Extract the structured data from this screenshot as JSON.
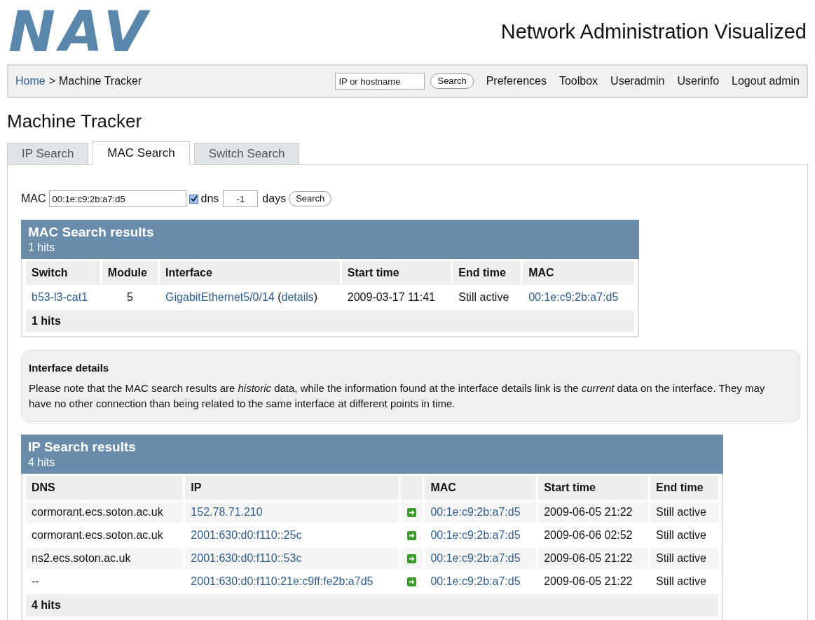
{
  "logo": "NAV",
  "site_title": "Network Administration Visualized",
  "navbar": {
    "breadcrumb": [
      {
        "label": "Home",
        "link": true
      },
      {
        "label": "Machine Tracker",
        "link": false
      }
    ],
    "separator": ">",
    "search": {
      "placeholder": "IP or hostname",
      "button": "Search"
    },
    "links": [
      "Preferences",
      "Toolbox",
      "Useradmin",
      "Userinfo",
      "Logout admin"
    ]
  },
  "page_title": "Machine Tracker",
  "tabs": [
    {
      "label": "IP Search",
      "selected": false
    },
    {
      "label": "MAC Search",
      "selected": true
    },
    {
      "label": "Switch Search",
      "selected": false
    }
  ],
  "form": {
    "mac_label": "MAC",
    "mac_value": "00:1e:c9:2b:a7:d5",
    "dns_checked": true,
    "dns_label": "dns",
    "days_value": "-1",
    "days_label": "days",
    "button": "Search"
  },
  "mac_results": {
    "title": "MAC Search results",
    "hits": "1 hits",
    "columns": [
      "Switch",
      "Module",
      "Interface",
      "Start time",
      "End time",
      "MAC"
    ],
    "rows": [
      {
        "switch": "b53-l3-cat1",
        "module": "5",
        "interface": "GigabitEthernet5/0/14",
        "details_open": "(",
        "details": "details",
        "details_close": ")",
        "start_time": "2009-03-17 11:41",
        "end_time": "Still active",
        "mac": "00:1e:c9:2b:a7:d5"
      }
    ],
    "footer": "1 hits"
  },
  "interface_details": {
    "title": "Interface details",
    "text": "Please note that the MAC search results are *historic* data, while the information found at the interface details link is the *current* data on the interface. They may have no other connection than being related to the same interface at different points in time."
  },
  "ip_results": {
    "title": "IP Search results",
    "hits": "4 hits",
    "columns": [
      "DNS",
      "IP",
      "MAC",
      "Start time",
      "End time"
    ],
    "rows": [
      {
        "dns": "cormorant.ecs.soton.ac.uk",
        "ip": "152.78.71.210",
        "mac": "00:1e:c9:2b:a7:d5",
        "start_time": "2009-06-05 21:22",
        "end_time": "Still active"
      },
      {
        "dns": "cormorant.ecs.soton.ac.uk",
        "ip": "2001:630:d0:f110::25c",
        "mac": "00:1e:c9:2b:a7:d5",
        "start_time": "2009-06-06 02:52",
        "end_time": "Still active"
      },
      {
        "dns": "ns2.ecs.soton.ac.uk",
        "ip": "2001:630:d0:f110::53c",
        "mac": "00:1e:c9:2b:a7:d5",
        "start_time": "2009-06-05 21:22",
        "end_time": "Still active"
      },
      {
        "dns": "--",
        "ip": "2001:630:d0:f110:21e:c9ff:fe2b:a7d5",
        "mac": "00:1e:c9:2b:a7:d5",
        "start_time": "2009-06-05 21:22",
        "end_time": "Still active"
      }
    ],
    "footer": "4 hits"
  }
}
